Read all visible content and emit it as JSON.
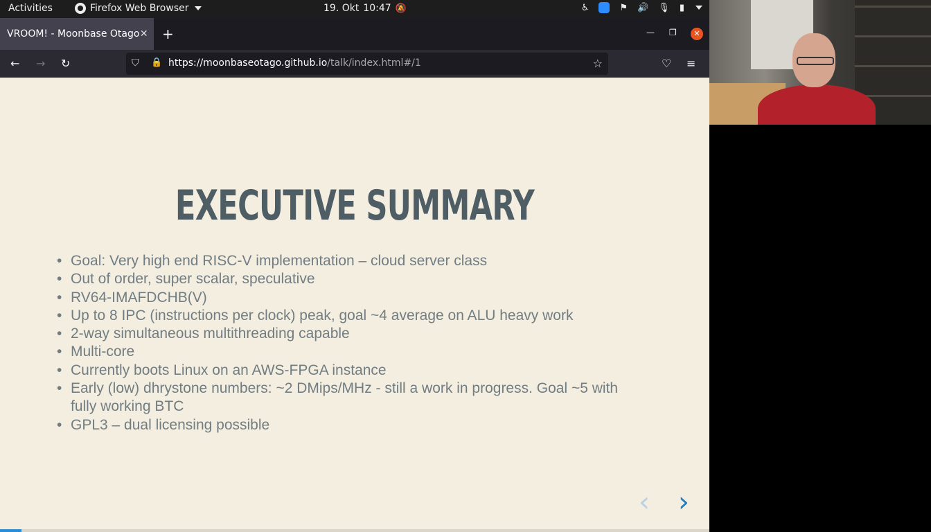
{
  "topbar": {
    "activities": "Activities",
    "app_name": "Firefox Web Browser",
    "date": "19. Okt",
    "time": "10:47"
  },
  "browser": {
    "tab_title": "VROOM! - Moonbase Otago",
    "url_domain": "https://moonbaseotago.github.io",
    "url_path": "/talk/index.html#/1"
  },
  "slide": {
    "title": "EXECUTIVE SUMMARY",
    "bullets": [
      "Goal: Very high end RISC-V implementation – cloud server class",
      "Out of order, super scalar, speculative",
      "RV64-IMAFDCHB(V)",
      "Up to 8 IPC (instructions per clock) peak, goal ~4 average on ALU heavy work",
      "2-way simultaneous multithreading capable",
      "Multi-core",
      "Currently boots Linux on an AWS-FPGA instance",
      "Early (low) dhrystone numbers: ~2 DMips/MHz - still a work in progress. Goal ~5 with fully working BTC",
      "GPL3 – dual licensing possible"
    ],
    "progress_fraction": 0.03
  },
  "colors": {
    "slide_bg": "#f4eee0",
    "title": "#4f5d65",
    "text": "#717d82",
    "accent": "#1f7fc4",
    "close_button": "#e95420"
  },
  "icons": [
    "firefox-icon",
    "bell-off-icon",
    "zoom-icon",
    "network-icon",
    "volume-icon",
    "mic-icon",
    "battery-icon",
    "shield-icon",
    "lock-icon",
    "star-icon",
    "pocket-icon",
    "menu-icon"
  ]
}
